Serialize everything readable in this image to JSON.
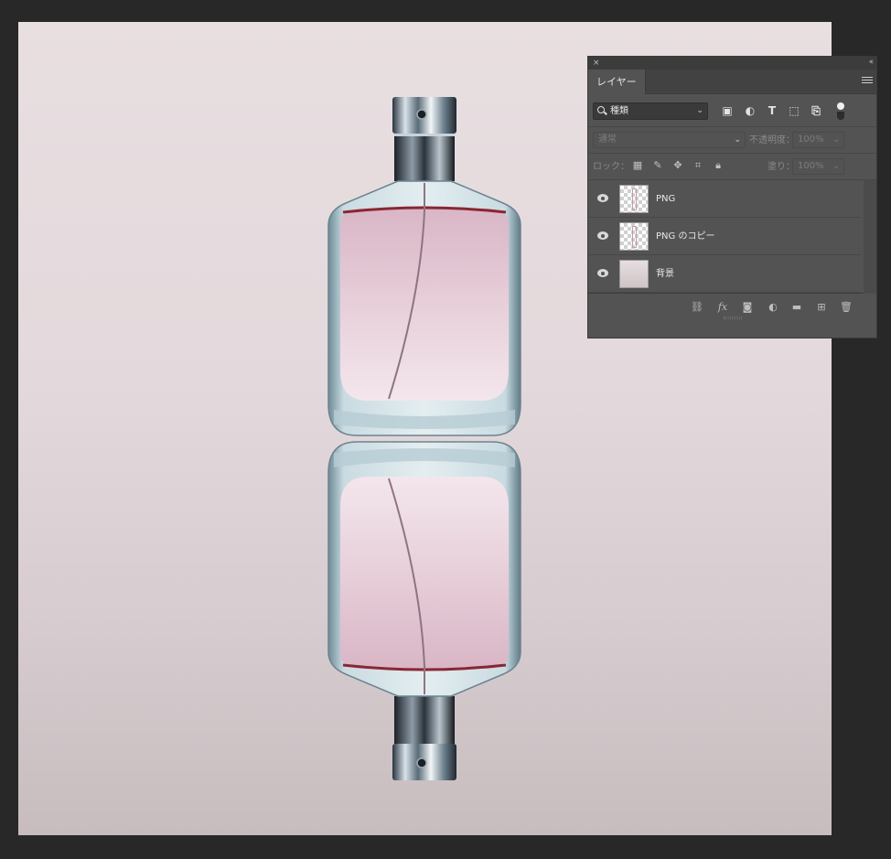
{
  "canvas": {
    "image": "perfume bottle with mirrored reflection"
  },
  "layers_panel": {
    "close_glyph": "×",
    "collapse_glyph": "‹‹",
    "tab_label": "レイヤー",
    "filter": {
      "value": "種類",
      "icons": [
        "image-filter-icon",
        "adjustment-filter-icon",
        "type-filter-icon",
        "shape-filter-icon",
        "smart-object-filter-icon"
      ]
    },
    "blend_mode": "通常",
    "opacity_label": "不透明度：",
    "opacity_value": "100%",
    "lock_label": "ロック：",
    "fill_label": "塗り：",
    "fill_value": "100%",
    "layers": [
      {
        "name": "PNG",
        "thumbnail": "transparent"
      },
      {
        "name": "PNG のコピー",
        "thumbnail": "transparent"
      },
      {
        "name": "背景",
        "thumbnail": "background"
      }
    ],
    "bottom_icons": [
      "link-icon",
      "fx-icon",
      "mask-icon",
      "adjustment-icon",
      "folder-icon",
      "new-layer-icon",
      "trash-icon"
    ],
    "fx_label": "fx"
  }
}
